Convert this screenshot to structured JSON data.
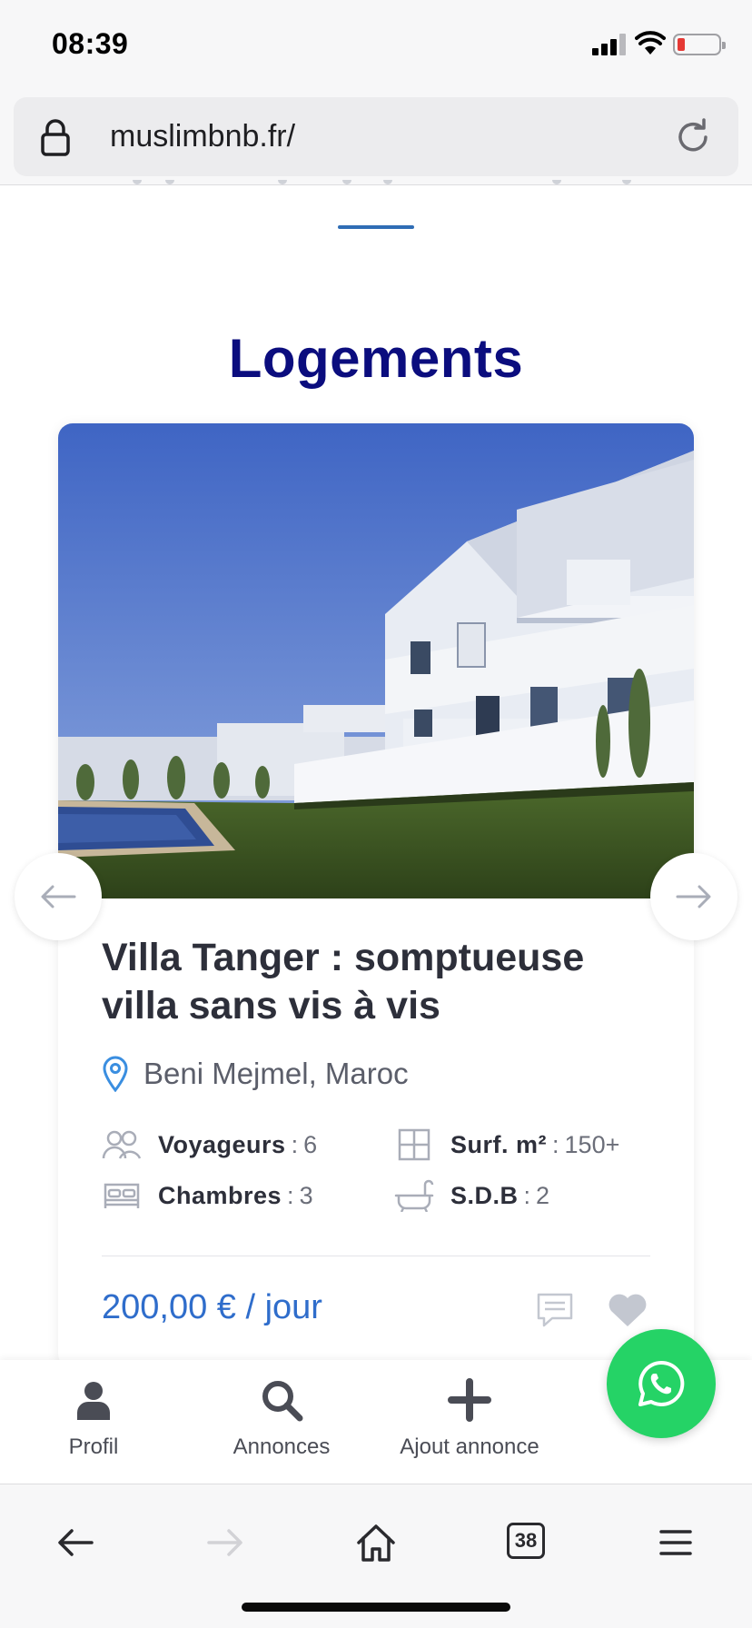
{
  "status_bar": {
    "time": "08:39"
  },
  "browser": {
    "url": "muslimbnb.fr/",
    "tabs_count": "38"
  },
  "section": {
    "title": "Logements"
  },
  "listing": {
    "title": "Villa Tanger : somptueuse villa sans vis à vis",
    "location": "Beni Mejmel, Maroc",
    "specs": {
      "travelers_label": "Voyageurs",
      "travelers_value": "6",
      "surface_label": "Surf. m²",
      "surface_value": "150+",
      "bedrooms_label": "Chambres",
      "bedrooms_value": "3",
      "bathrooms_label": "S.D.B",
      "bathrooms_value": "2",
      "separator": ":"
    },
    "price": "200,00 € / jour"
  },
  "nav": {
    "profile": "Profil",
    "listings": "Annonces",
    "add_listing": "Ajout annonce"
  },
  "colors": {
    "title_blue": "#0b0d7e",
    "accent_blue": "#2f6db5",
    "price_blue": "#2f6dcb",
    "whatsapp_green": "#25d366"
  }
}
